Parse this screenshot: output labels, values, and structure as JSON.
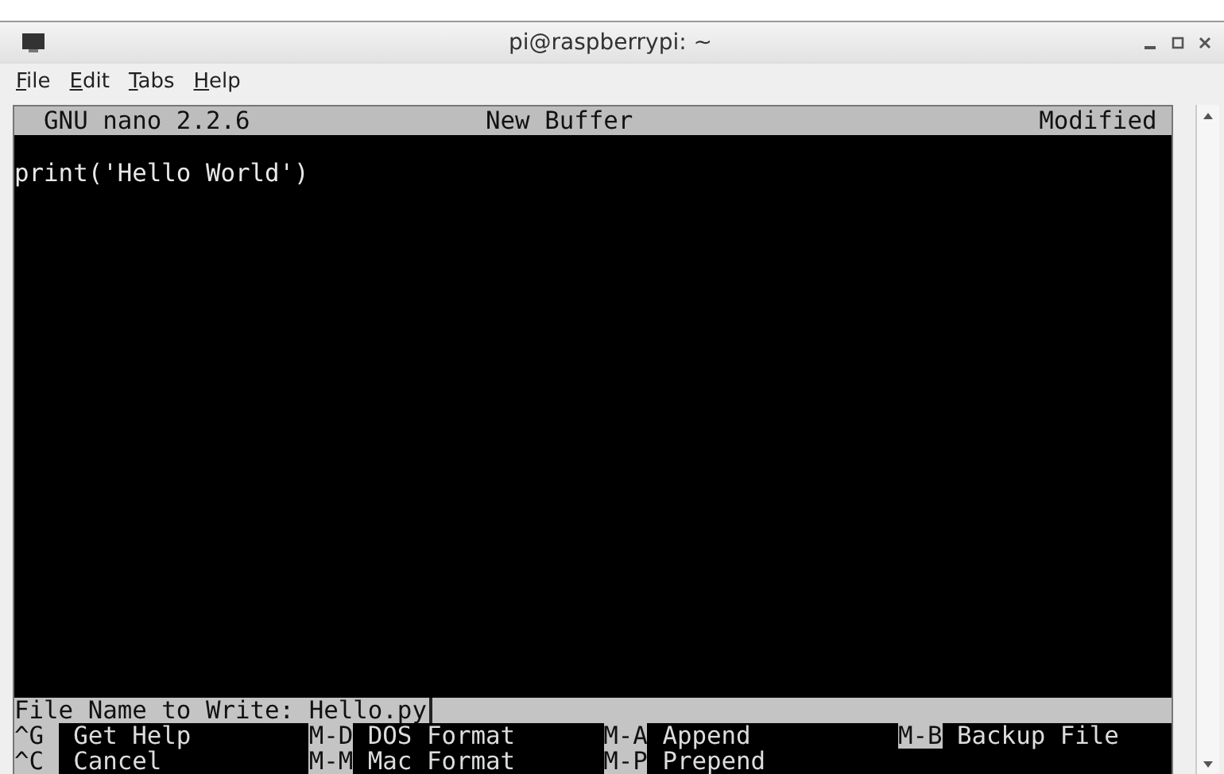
{
  "window": {
    "title": "pi@raspberrypi: ~"
  },
  "menu": [
    {
      "label": "File"
    },
    {
      "label": "Edit"
    },
    {
      "label": "Tabs"
    },
    {
      "label": "Help"
    }
  ],
  "status_bar": {
    "version": "GNU nano 2.2.6",
    "buffer": "New Buffer",
    "state": "Modified"
  },
  "editor": {
    "lines": [
      "print('Hello World')"
    ]
  },
  "prompt": {
    "label": "File Name to Write:",
    "value": "Hello.py"
  },
  "shortcuts": [
    {
      "key": "^G",
      "label": "Get Help"
    },
    {
      "key": "M-D",
      "label": "DOS Format"
    },
    {
      "key": "M-A",
      "label": "Append"
    },
    {
      "key": "M-B",
      "label": "Backup File"
    },
    {
      "key": "^C",
      "label": "Cancel"
    },
    {
      "key": "M-M",
      "label": "Mac Format"
    },
    {
      "key": "M-P",
      "label": "Prepend"
    }
  ]
}
